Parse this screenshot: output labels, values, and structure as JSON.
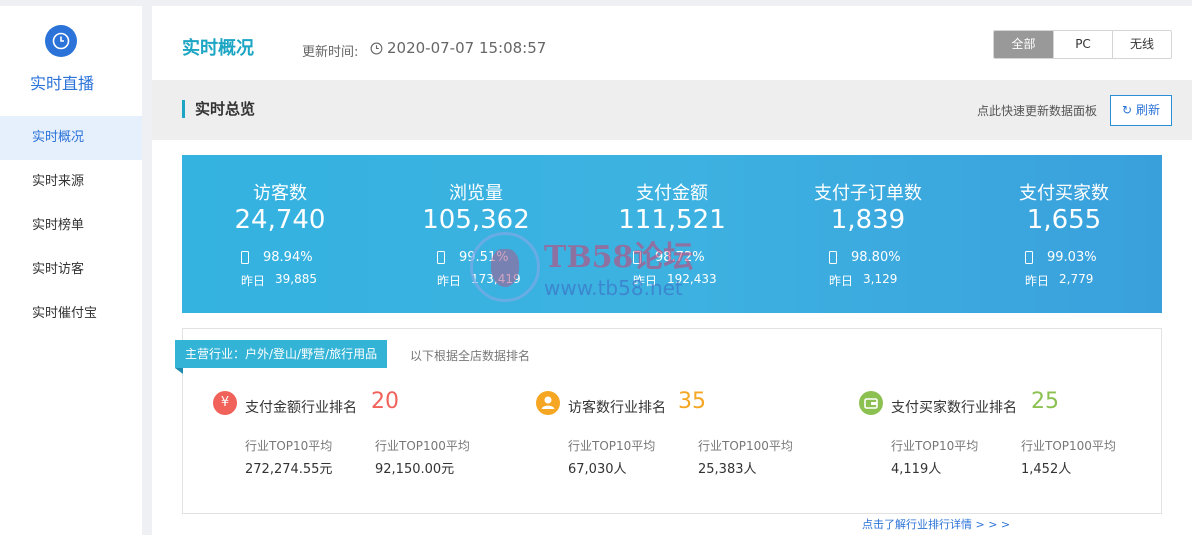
{
  "sidebar": {
    "title": "实时直播",
    "items": [
      {
        "label": "实时概况",
        "active": true
      },
      {
        "label": "实时来源",
        "active": false
      },
      {
        "label": "实时榜单",
        "active": false
      },
      {
        "label": "实时访客",
        "active": false
      },
      {
        "label": "实时催付宝",
        "active": false
      }
    ]
  },
  "header": {
    "title": "实时概况",
    "update_label": "更新时间:",
    "update_time": "2020-07-07 15:08:57",
    "device_tabs": [
      {
        "label": "全部",
        "selected": true
      },
      {
        "label": "PC",
        "selected": false
      },
      {
        "label": "无线",
        "selected": false
      }
    ]
  },
  "overview": {
    "title": "实时总览",
    "hint": "点此快速更新数据面板",
    "refresh_label": "刷新"
  },
  "stats": [
    {
      "label": "访客数",
      "value": "24,740",
      "mobile_pct": "98.94%",
      "yesterday_label": "昨日",
      "yesterday": "39,885"
    },
    {
      "label": "浏览量",
      "value": "105,362",
      "mobile_pct": "99.51%",
      "yesterday_label": "昨日",
      "yesterday": "173,419"
    },
    {
      "label": "支付金额",
      "value": "111,521",
      "mobile_pct": "98.72%",
      "yesterday_label": "昨日",
      "yesterday": "192,433"
    },
    {
      "label": "支付子订单数",
      "value": "1,839",
      "mobile_pct": "98.80%",
      "yesterday_label": "昨日",
      "yesterday": "3,129"
    },
    {
      "label": "支付买家数",
      "value": "1,655",
      "mobile_pct": "99.03%",
      "yesterday_label": "昨日",
      "yesterday": "2,779"
    }
  ],
  "industry": {
    "tag": "主营行业：户外/登山/野营/旅行用品",
    "note": "以下根据全店数据排名",
    "rankings": [
      {
        "icon": "yen-icon",
        "icon_char": "¥",
        "color": "#f0625a",
        "label": "支付金额行业排名",
        "rank": "20",
        "top10_label": "行业TOP10平均",
        "top10": "272,274.55元",
        "top100_label": "行业TOP100平均",
        "top100": "92,150.00元"
      },
      {
        "icon": "person-icon",
        "icon_char": "●",
        "color": "#f5a623",
        "label": "访客数行业排名",
        "rank": "35",
        "top10_label": "行业TOP10平均",
        "top10": "67,030人",
        "top100_label": "行业TOP100平均",
        "top100": "25,383人"
      },
      {
        "icon": "wallet-icon",
        "icon_char": "▭",
        "color": "#8cc152",
        "label": "支付买家数行业排名",
        "rank": "25",
        "top10_label": "行业TOP10平均",
        "top10": "4,119人",
        "top100_label": "行业TOP100平均",
        "top100": "1,452人"
      }
    ]
  },
  "more_link": "点击了解行业排行详情 > > >",
  "watermark": {
    "line1": "TB58论坛",
    "line2": "www.tb58.net"
  }
}
